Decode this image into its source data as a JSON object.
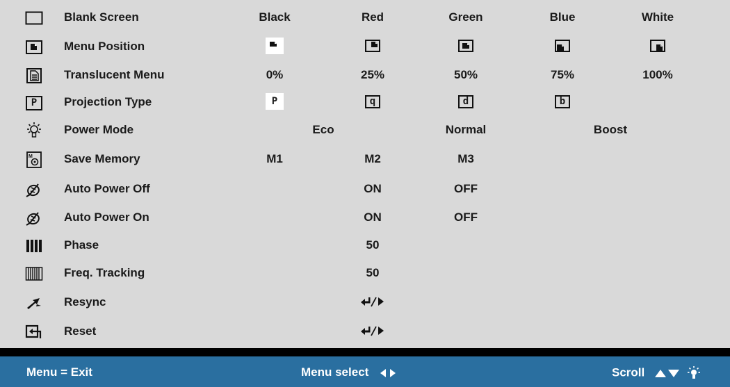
{
  "menu": {
    "rows": [
      {
        "icon": "blank-screen-icon",
        "label": "Blank Screen",
        "options": [
          "Black",
          "Red",
          "Green",
          "Blue",
          "White"
        ]
      },
      {
        "icon": "menu-position-icon",
        "label": "Menu Position",
        "options": [
          "top-left",
          "top-right",
          "center",
          "bottom-left",
          "bottom-right"
        ],
        "selected": 0
      },
      {
        "icon": "translucent-menu-icon",
        "label": "Translucent Menu",
        "options": [
          "0%",
          "25%",
          "50%",
          "75%",
          "100%"
        ]
      },
      {
        "icon": "projection-type-icon",
        "label": "Projection Type",
        "options": [
          "P",
          "q",
          "d",
          "b"
        ],
        "selected": 0
      },
      {
        "icon": "power-mode-icon",
        "label": "Power Mode",
        "options": [
          "Eco",
          "Normal",
          "Boost"
        ]
      },
      {
        "icon": "save-memory-icon",
        "label": "Save Memory",
        "options": [
          "M1",
          "M2",
          "M3"
        ]
      },
      {
        "icon": "auto-power-off-icon",
        "label": "Auto Power Off",
        "options": [
          "ON",
          "OFF"
        ]
      },
      {
        "icon": "auto-power-on-icon",
        "label": "Auto Power On",
        "options": [
          "ON",
          "OFF"
        ]
      },
      {
        "icon": "phase-icon",
        "label": "Phase",
        "value": "50"
      },
      {
        "icon": "freq-tracking-icon",
        "label": "Freq. Tracking",
        "value": "50"
      },
      {
        "icon": "resync-icon",
        "label": "Resync",
        "action": "enter-or-right-icon"
      },
      {
        "icon": "reset-icon",
        "label": "Reset",
        "action": "enter-or-right-icon"
      }
    ]
  },
  "footer": {
    "exit": "Menu = Exit",
    "select": "Menu select",
    "scroll": "Scroll"
  }
}
